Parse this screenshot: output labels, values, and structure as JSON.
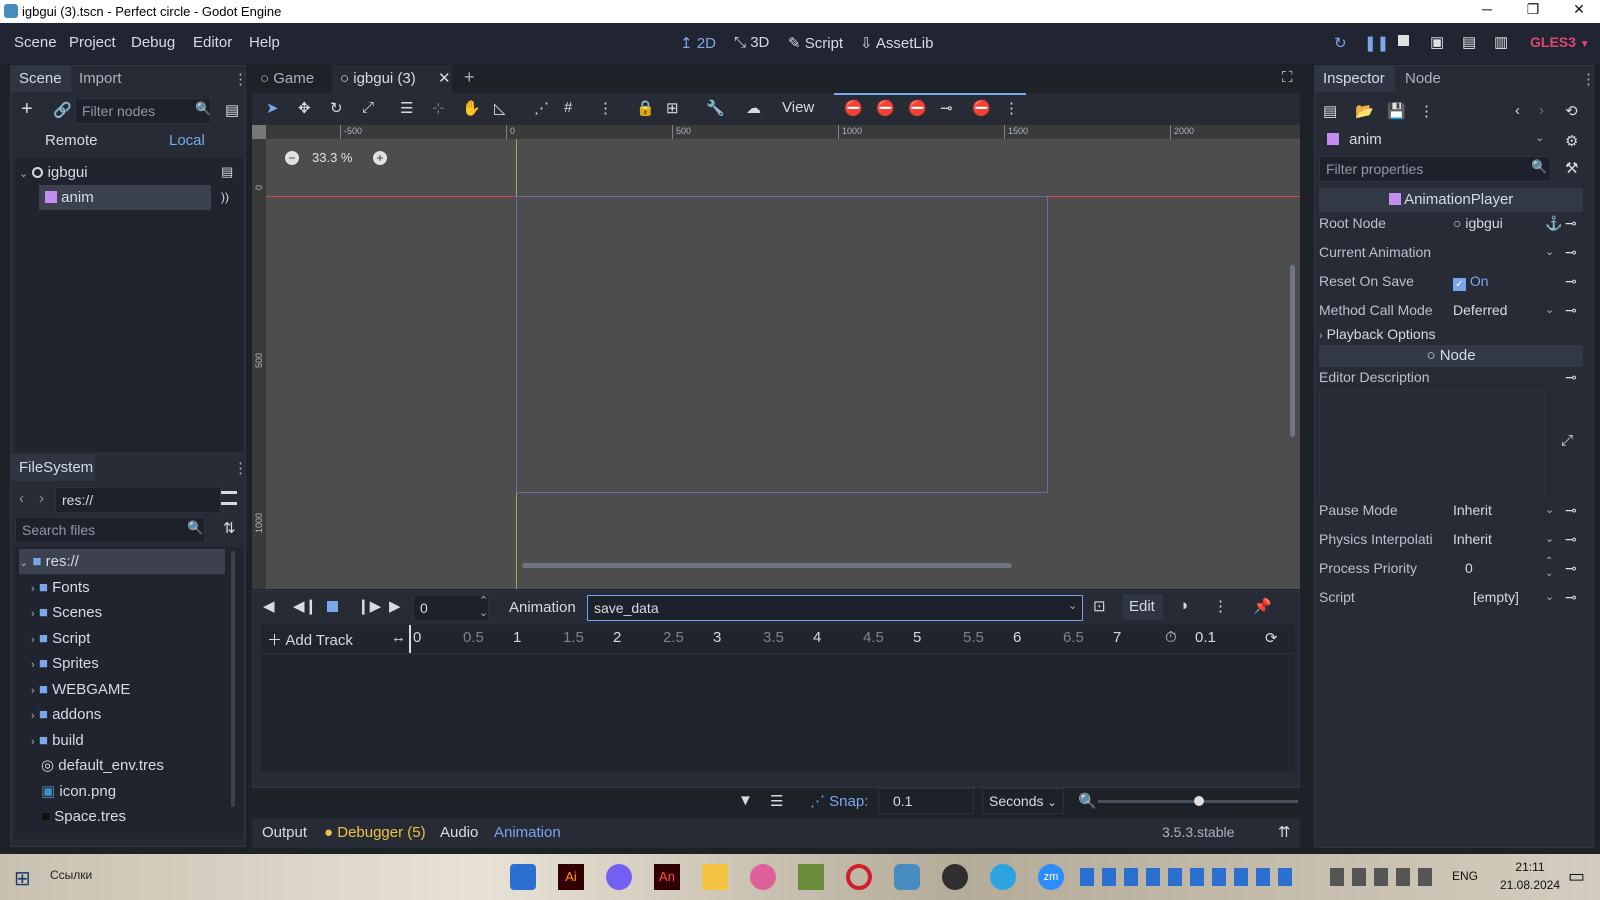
{
  "titlebar": {
    "title": "igbgui (3).tscn - Perfect circle - Godot Engine"
  },
  "menu": [
    "Scene",
    "Project",
    "Debug",
    "Editor",
    "Help"
  ],
  "workspaces": [
    {
      "label": "2D",
      "icon": "2d-icon"
    },
    {
      "label": "3D",
      "icon": "3d-icon"
    },
    {
      "label": "Script",
      "icon": "script-icon"
    },
    {
      "label": "AssetLib",
      "icon": "assetlib-icon"
    }
  ],
  "renderer": "GLES3",
  "scene_dock": {
    "tabs": [
      "Scene",
      "Import"
    ],
    "filter_placeholder": "Filter nodes",
    "remote": "Remote",
    "local": "Local",
    "nodes": [
      {
        "name": "igbgui"
      },
      {
        "name": "anim"
      }
    ]
  },
  "filesystem": {
    "title": "FileSystem",
    "path": "res://",
    "search_placeholder": "Search files",
    "items": [
      "res://",
      "Fonts",
      "Scenes",
      "Script",
      "Sprites",
      "WEBGAME",
      "addons",
      "build",
      "default_env.tres",
      "icon.png",
      "Space.tres"
    ]
  },
  "editor_tabs": [
    "Game",
    "igbgui (3)"
  ],
  "toolbar": {
    "view": "View"
  },
  "viewport": {
    "zoom": "33.3 %",
    "ruler_x": [
      "-500",
      "0",
      "500",
      "1000",
      "1500",
      "2000"
    ],
    "ruler_y": [
      "0",
      "500",
      "1000"
    ]
  },
  "animation": {
    "frame_value": "0",
    "label": "Animation",
    "current": "save_data",
    "edit": "Edit",
    "add_track": "Add Track",
    "timeline": [
      "0",
      "0.5",
      "1",
      "1.5",
      "2",
      "2.5",
      "3",
      "3.5",
      "4",
      "4.5",
      "5",
      "5.5",
      "6",
      "6.5",
      "7"
    ],
    "length": "0.1",
    "snap_label": "Snap:",
    "snap_value": "0.1",
    "snap_unit": "Seconds"
  },
  "bottom_tabs": {
    "output": "Output",
    "debugger": "Debugger (5)",
    "audio": "Audio",
    "animation": "Animation",
    "version": "3.5.3.stable"
  },
  "inspector": {
    "tabs": [
      "Inspector",
      "Node"
    ],
    "object": "anim",
    "filter_placeholder": "Filter properties",
    "class": "AnimationPlayer",
    "props": [
      {
        "name": "Root Node",
        "value": "igbgui"
      },
      {
        "name": "Current Animation",
        "value": ""
      },
      {
        "name": "Reset On Save",
        "value": "On"
      },
      {
        "name": "Method Call Mode",
        "value": "Deferred"
      }
    ],
    "section": "Playback Options",
    "node_section": "Node",
    "editor_description": "Editor Description",
    "props2": [
      {
        "name": "Pause Mode",
        "value": "Inherit"
      },
      {
        "name": "Physics Interpolati",
        "value": "Inherit"
      },
      {
        "name": "Process Priority",
        "value": "0"
      },
      {
        "name": "Script",
        "value": "[empty]"
      }
    ]
  },
  "taskbar": {
    "links": "Ссылки",
    "lang": "ENG",
    "time": "21:11",
    "date": "21.08.2024"
  },
  "colors": {
    "accent": "#7aa6ec",
    "bg": "#1d2229",
    "panel": "#262b36",
    "viewport": "#4d4d4d",
    "renderer": "#e0466e"
  }
}
